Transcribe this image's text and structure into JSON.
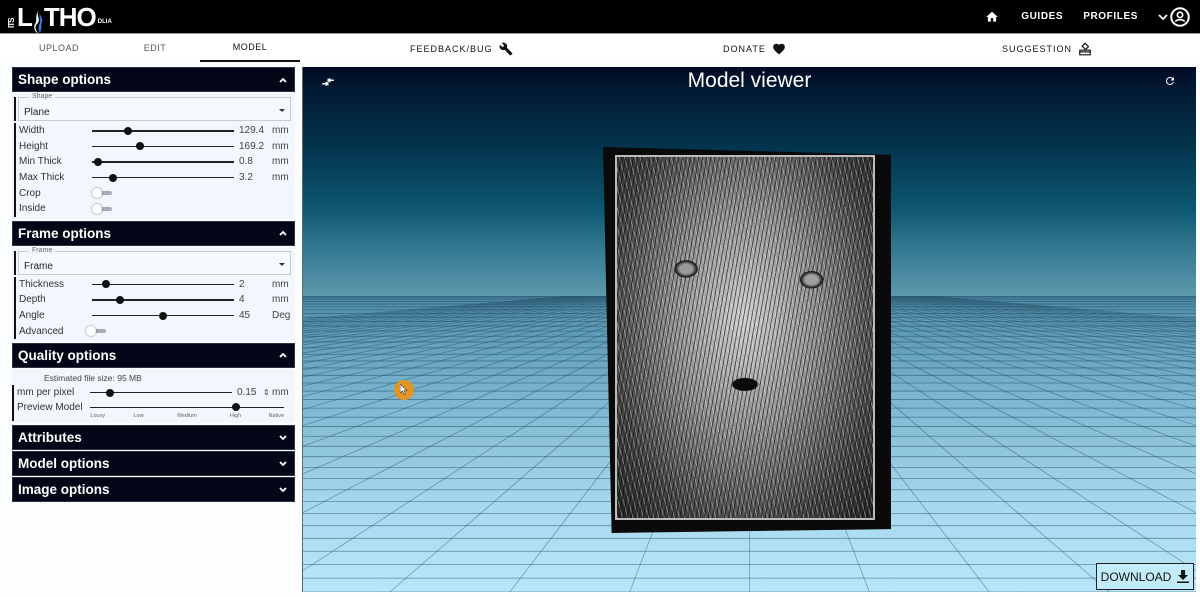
{
  "brand": {
    "prefix": "ITS",
    "name_left": "L",
    "name_right": "THO",
    "suffix": "DLIA"
  },
  "topnav": {
    "home_icon": "home-icon",
    "links": [
      "GUIDES",
      "PROFILES"
    ],
    "profile_icon": "account-circle-icon"
  },
  "tabs": [
    {
      "label": "UPLOAD",
      "active": false
    },
    {
      "label": "EDIT",
      "active": false
    },
    {
      "label": "MODEL",
      "active": true
    }
  ],
  "toplinks": [
    {
      "label": "FEEDBACK/BUG",
      "icon": "wrench-icon"
    },
    {
      "label": "DONATE",
      "icon": "heart-icon"
    },
    {
      "label": "SUGGESTION",
      "icon": "ballot-box-icon"
    }
  ],
  "panels": {
    "shape": {
      "title": "Shape options",
      "expanded": true,
      "select": {
        "legend": "Shape",
        "value": "Plane"
      },
      "sliders": [
        {
          "label": "Width",
          "value": "129.4",
          "unit": "mm",
          "fraction": 0.25
        },
        {
          "label": "Height",
          "value": "169.2",
          "unit": "mm",
          "fraction": 0.34
        },
        {
          "label": "Min Thick",
          "value": "0.8",
          "unit": "mm",
          "fraction": 0.04
        },
        {
          "label": "Max Thick",
          "value": "3.2",
          "unit": "mm",
          "fraction": 0.15
        }
      ],
      "toggles": [
        {
          "label": "Crop",
          "on": false
        },
        {
          "label": "Inside",
          "on": false
        }
      ]
    },
    "frame": {
      "title": "Frame options",
      "expanded": true,
      "select": {
        "legend": "Frame",
        "value": "Frame"
      },
      "sliders": [
        {
          "label": "Thickness",
          "value": "2",
          "unit": "mm",
          "fraction": 0.1
        },
        {
          "label": "Depth",
          "value": "4",
          "unit": "mm",
          "fraction": 0.2
        },
        {
          "label": "Angle",
          "value": "45",
          "unit": "Deg",
          "fraction": 0.5
        }
      ],
      "toggles": [
        {
          "label": "Advanced",
          "on": false
        }
      ]
    },
    "quality": {
      "title": "Quality options",
      "expanded": true,
      "estimate": "Estimated file size: 95 MB",
      "mm_per_pixel": {
        "label": "mm per pixel",
        "value": "0.15",
        "unit": "mm",
        "fraction": 0.14
      },
      "preview": {
        "label": "Preview Model",
        "steps": [
          "Lousy",
          "Low",
          "Medium",
          "High",
          "Native"
        ],
        "selected": "High",
        "selected_index": 3
      }
    },
    "collapsed": [
      {
        "title": "Attributes"
      },
      {
        "title": "Model options"
      },
      {
        "title": "Image options"
      }
    ]
  },
  "viewer": {
    "title": "Model viewer",
    "download_label": "DOWNLOAD",
    "model_image": "cat-face-lithophane"
  }
}
